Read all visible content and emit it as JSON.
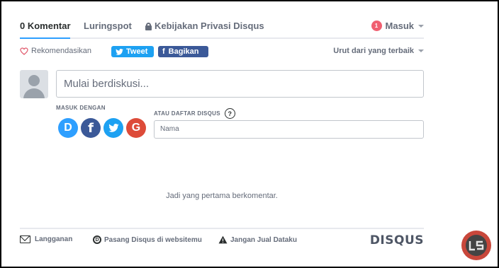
{
  "nav": {
    "tabs": [
      {
        "label": "0 Komentar"
      },
      {
        "label": "Luringspot"
      },
      {
        "label": "Kebijakan Privasi Disqus"
      }
    ],
    "login": {
      "badge": "1",
      "label": "Masuk"
    }
  },
  "toolbar": {
    "recommend_label": "Rekomendasikan",
    "tweet_label": "Tweet",
    "share_label": "Bagikan",
    "sort_label": "Urut dari yang terbaik"
  },
  "composer": {
    "placeholder": "Mulai berdiskusi...",
    "login_with_label": "MASUK DENGAN",
    "register_label": "ATAU DAFTAR DISQUS",
    "help_glyph": "?",
    "name_placeholder": "Nama",
    "social": [
      {
        "name": "disqus",
        "glyph": "D",
        "color": "#2e9fff"
      },
      {
        "name": "facebook",
        "glyph": "f",
        "color": "#3b5998"
      },
      {
        "name": "twitter",
        "glyph": "",
        "color": "#1da1f2"
      },
      {
        "name": "google",
        "glyph": "G",
        "color": "#dd4b39"
      }
    ]
  },
  "empty_message": "Jadi yang pertama berkomentar.",
  "footer": {
    "subscribe_label": "Langganan",
    "install_label": "Pasang Disqus di websitemu",
    "do_not_sell_label": "Jangan Jual Dataku",
    "brand": "DISQUS"
  },
  "colors": {
    "accent": "#2e9fff",
    "badge": "#f05f70",
    "text": "#2a2e2e",
    "muted": "#656c7a"
  }
}
